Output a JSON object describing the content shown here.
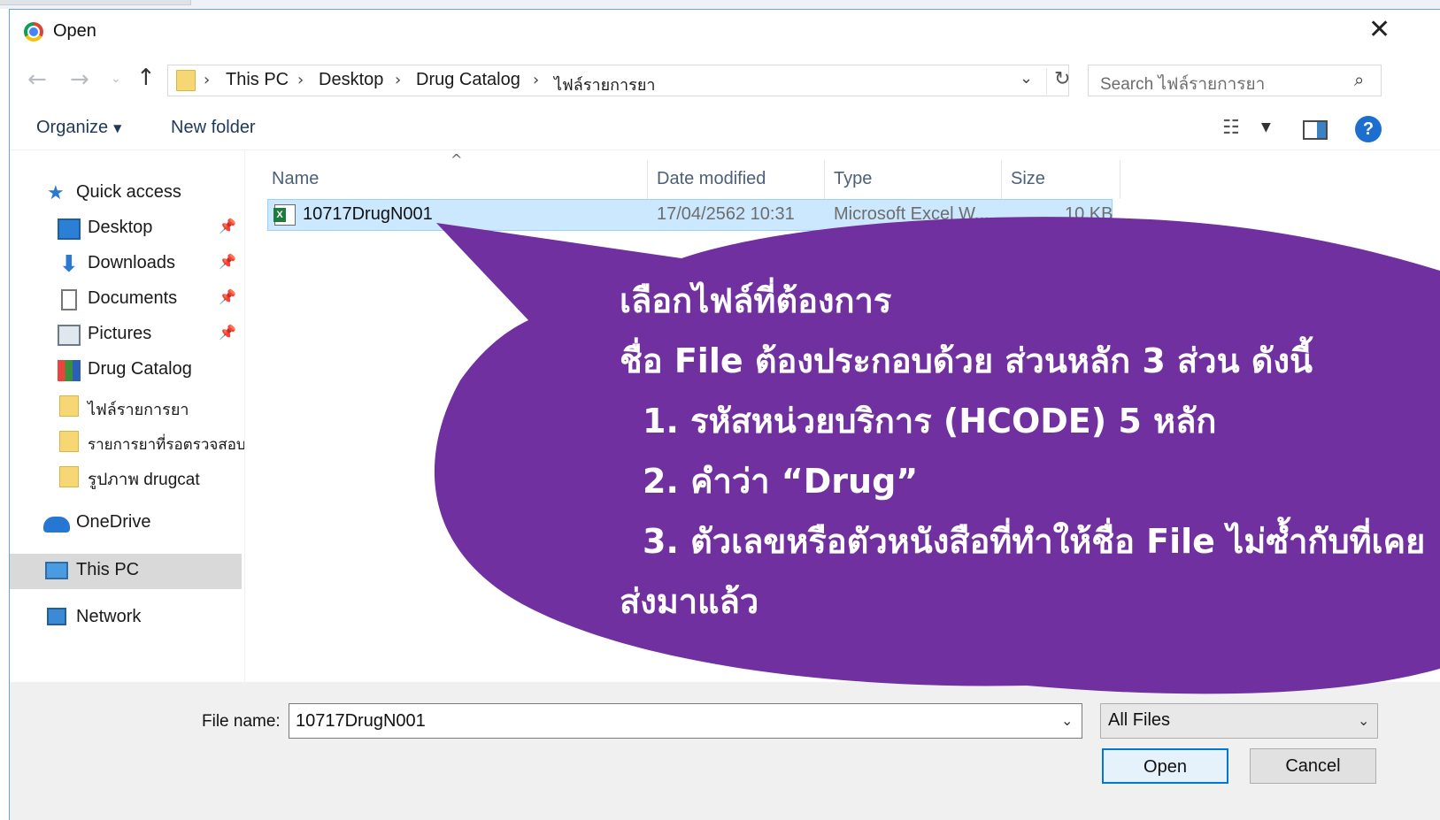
{
  "window": {
    "title": "Open",
    "close_glyph": "✕"
  },
  "nav": {
    "back": "←",
    "forward": "→",
    "recent": "⌄",
    "up": "↑"
  },
  "address": {
    "crumbs": [
      "This PC",
      "Desktop",
      "Drug Catalog",
      "ไฟล์รายการยา"
    ],
    "separator": "›",
    "dropdown": "⌄",
    "refresh": "↻"
  },
  "search": {
    "placeholder": "Search ไฟล์รายการยา",
    "icon": "search-icon"
  },
  "toolbar": {
    "organize": "Organize",
    "organize_caret": "▼",
    "new_folder": "New folder",
    "view_glyph": "☷",
    "view_caret": "▼",
    "help": "?"
  },
  "sidebar": {
    "pin_glyph": "📌",
    "items": [
      {
        "label": "Quick access",
        "icon": "star-icon"
      },
      {
        "label": "Desktop",
        "icon": "desktop-icon",
        "pinned": true
      },
      {
        "label": "Downloads",
        "icon": "download-icon",
        "pinned": true
      },
      {
        "label": "Documents",
        "icon": "documents-icon",
        "pinned": true
      },
      {
        "label": "Pictures",
        "icon": "pictures-icon",
        "pinned": true
      },
      {
        "label": "Drug Catalog",
        "icon": "drug-catalog-icon"
      },
      {
        "label": "ไฟล์รายการยา",
        "icon": "folder-icon"
      },
      {
        "label": "รายการยาที่รอตรวจสอบ",
        "icon": "folder-icon"
      },
      {
        "label": "รูปภาพ drugcat",
        "icon": "folder-icon"
      },
      {
        "label": "OneDrive",
        "icon": "onedrive-icon"
      },
      {
        "label": "This PC",
        "icon": "this-pc-icon",
        "selected": true
      },
      {
        "label": "Network",
        "icon": "network-icon"
      }
    ]
  },
  "filelist": {
    "sort_glyph": "^",
    "columns": [
      "Name",
      "Date modified",
      "Type",
      "Size"
    ],
    "rows": [
      {
        "name": "10717DrugN001",
        "date": "17/04/2562 10:31",
        "type": "Microsoft Excel W...",
        "size": "10 KB"
      }
    ]
  },
  "footer": {
    "file_name_label": "File name:",
    "file_name_value": "10717DrugN001",
    "file_type": "All Files",
    "caret": "⌄",
    "open_button": "Open",
    "cancel_button": "Cancel"
  },
  "callout": {
    "color": "#7030a0",
    "lines": [
      "เลือกไฟล์ที่ต้องการ",
      "ชื่อ File ต้องประกอบด้วย ส่วนหลัก 3 ส่วน ดังนี้",
      "1. รหัสหน่วยบริการ (HCODE) 5 หลัก",
      "2. คำว่า “Drug”",
      "3. ตัวเลขหรือตัวหนังสือที่ทำให้ชื่อ File ไม่ซ้ำกับที่เคย",
      "ส่งมาแล้ว"
    ]
  }
}
